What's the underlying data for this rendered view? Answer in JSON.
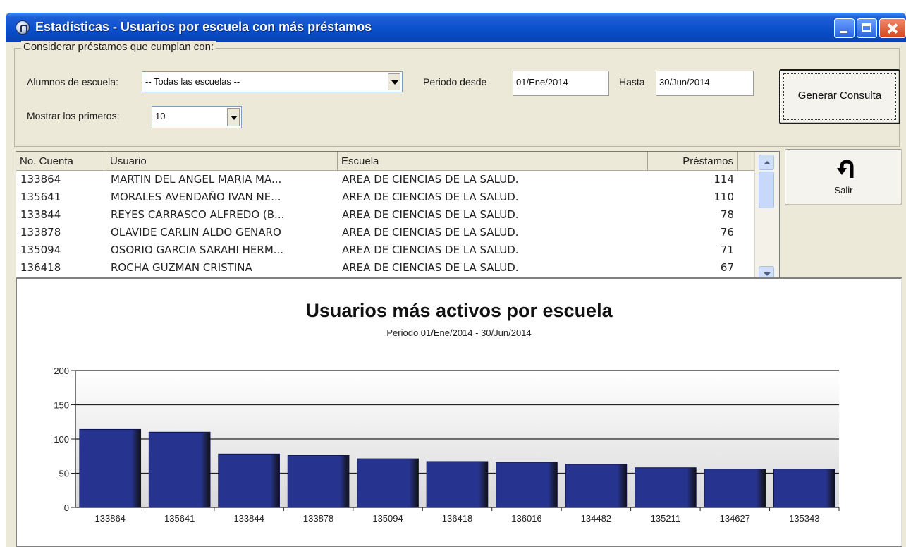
{
  "window": {
    "title": "Estadísticas - Usuarios por escuela con más préstamos"
  },
  "criteria": {
    "legend": "Considerar préstamos que cumplan con:",
    "school_label": "Alumnos de escuela:",
    "school_value": "-- Todas las escuelas --",
    "period_from_label": "Periodo desde",
    "period_from_value": "01/Ene/2014",
    "period_to_label": "Hasta",
    "period_to_value": "30/Jun/2014",
    "show_first_label": "Mostrar los primeros:",
    "show_first_value": "10",
    "generate_button": "Generar Consulta"
  },
  "exit_button": {
    "label": "Salir",
    "icon": "return-arrow-icon"
  },
  "grid": {
    "columns": [
      "No. Cuenta",
      "Usuario",
      "Escuela",
      "Préstamos"
    ],
    "rows": [
      [
        "133864",
        "MARTIN DEL ANGEL MARIA MA...",
        "AREA DE CIENCIAS DE LA SALUD.",
        "114"
      ],
      [
        "135641",
        "MORALES AVENDAÑO IVAN NE...",
        "AREA DE CIENCIAS DE LA SALUD.",
        "110"
      ],
      [
        "133844",
        "REYES CARRASCO ALFREDO (B...",
        "AREA DE CIENCIAS DE LA SALUD.",
        "78"
      ],
      [
        "133878",
        "OLAVIDE CARLIN ALDO GENARO",
        "AREA DE CIENCIAS DE LA SALUD.",
        "76"
      ],
      [
        "135094",
        "OSORIO GARCIA SARAHI HERM...",
        "AREA DE CIENCIAS DE LA SALUD.",
        "71"
      ],
      [
        "136418",
        "ROCHA GUZMAN CRISTINA",
        "AREA DE CIENCIAS DE LA SALUD.",
        "67"
      ]
    ]
  },
  "colors": {
    "bar": "#26348f",
    "bar_edge": "#0c1250",
    "titlebar": "#0a4ecb"
  },
  "chart_data": {
    "type": "bar",
    "title": "Usuarios más activos por escuela",
    "subtitle": "Periodo 01/Ene/2014 - 30/Jun/2014",
    "categories": [
      "133864",
      "135641",
      "133844",
      "133878",
      "135094",
      "136418",
      "136016",
      "134482",
      "135211",
      "134627",
      "135343"
    ],
    "values": [
      114,
      110,
      78,
      76,
      71,
      67,
      66,
      63,
      58,
      56,
      56
    ],
    "ylim": [
      0,
      200
    ],
    "yticks": [
      0,
      50,
      100,
      150,
      200
    ],
    "xlabel": "",
    "ylabel": "",
    "grid": true,
    "legend": "none"
  }
}
